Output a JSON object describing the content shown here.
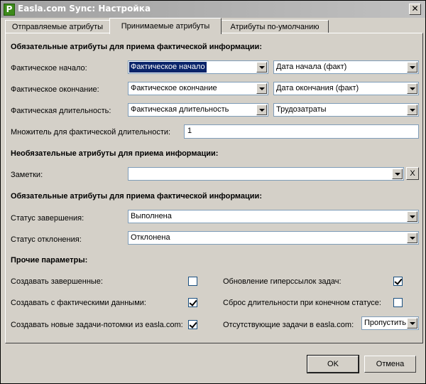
{
  "window": {
    "title": "Easla.com Sync: Настройка",
    "app_icon_letter": "P",
    "close_glyph": "✕"
  },
  "tabs": [
    {
      "label": "Отправляемые атрибуты"
    },
    {
      "label": "Принимаемые атрибуты"
    },
    {
      "label": "Атрибуты по-умолчанию"
    }
  ],
  "section1": {
    "header": "Обязательные атрибуты для приема фактической информации:",
    "rows": [
      {
        "label": "Фактическое начало:",
        "left": "Фактическое начало",
        "right": "Дата начала (факт)"
      },
      {
        "label": "Фактическое окончание:",
        "left": "Фактическое окончание",
        "right": "Дата окончания (факт)"
      },
      {
        "label": "Фактическая длительность:",
        "left": "Фактическая длительность",
        "right": "Трудозатраты"
      }
    ],
    "multiplier_label": "Множитель для фактической длительности:",
    "multiplier_value": "1"
  },
  "section2": {
    "header": "Необязательные атрибуты для приема информации:",
    "notes_label": "Заметки:",
    "notes_value": "",
    "clear_button": "X"
  },
  "section3": {
    "header": "Обязательные атрибуты для приема фактической информации:",
    "status_done_label": "Статус завершения:",
    "status_done_value": "Выполнена",
    "status_reject_label": "Статус отклонения:",
    "status_reject_value": "Отклонена"
  },
  "section4": {
    "header": "Прочие параметры:",
    "options": [
      {
        "label": "Создавать завершенные:",
        "checked": false
      },
      {
        "label": "Создавать с фактическими данными:",
        "checked": true
      },
      {
        "label": "Создавать новые задачи-потомки из easla.com:",
        "checked": true
      },
      {
        "label": "Обновление гиперссылок задач:",
        "checked": true
      },
      {
        "label": "Сброс длительности при конечном статусе:",
        "checked": false
      }
    ],
    "missing_label": "Отсутствующие задачи в easla.com:",
    "missing_value": "Пропустить"
  },
  "buttons": {
    "ok": "OK",
    "cancel": "Отмена"
  }
}
